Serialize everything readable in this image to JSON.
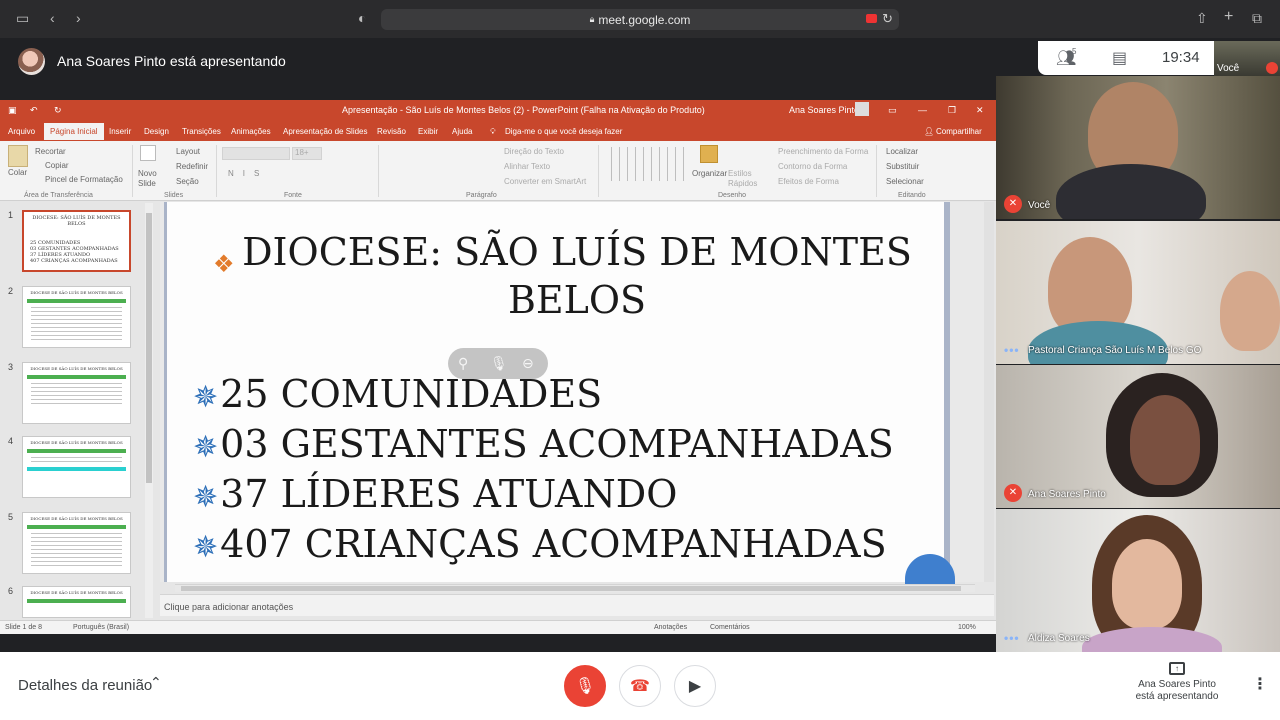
{
  "browser": {
    "url": "meet.google.com"
  },
  "meet": {
    "presenter_banner": "Ana Soares Pinto está apresentando",
    "participant_count": "5",
    "clock": "19:34",
    "self_thumb_label": "Você",
    "bottom": {
      "details_label": "Detalhes da reunião",
      "present_line1": "Ana Soares Pinto",
      "present_line2": "está apresentando"
    },
    "tiles": [
      {
        "name": "Você",
        "muted": true
      },
      {
        "name": "Pastoral Criança São Luís M Belos GO",
        "muted": false
      },
      {
        "name": "Ana Soares Pinto",
        "muted": true
      },
      {
        "name": "Aldiza Soares",
        "muted": false
      }
    ]
  },
  "ppt": {
    "title": "Apresentação - São Luís de Montes Belos (2)  -  PowerPoint (Falha na Ativação do Produto)",
    "user": "Ana Soares Pinto",
    "menu": [
      "Arquivo",
      "Página Inicial",
      "Inserir",
      "Design",
      "Transições",
      "Animações",
      "Apresentação de Slides",
      "Revisão",
      "Exibir",
      "Ajuda"
    ],
    "tell_me": "Diga-me o que você deseja fazer",
    "share": "Compartilhar",
    "ribbon": {
      "colar": "Colar",
      "recortar": "Recortar",
      "copiar": "Copiar",
      "pincel": "Pincel de Formatação",
      "area_transferencia": "Área de Transferência",
      "novo_slide": "Novo Slide",
      "layout": "Layout",
      "redefinir": "Redefinir",
      "secao": "Seção",
      "slides": "Slides",
      "fonte": "Fonte",
      "direcao_texto": "Direção do Texto",
      "alinhar_texto": "Alinhar Texto",
      "smartart": "Converter em SmartArt",
      "paragrafo": "Parágrafo",
      "organizar": "Organizar",
      "estilos_rapidos": "Estilos Rápidos",
      "preenchimento": "Preenchimento da Forma",
      "contorno": "Contorno da Forma",
      "efeitos": "Efeitos de Forma",
      "desenho": "Desenho",
      "localizar": "Localizar",
      "substituir": "Substituir",
      "selecionar": "Selecionar",
      "editando": "Editando",
      "font_size": "18+"
    },
    "thumbs": [
      {
        "num": "1",
        "title": "DIOCESE: SÃO LUÍS DE MONTES BELOS",
        "lines": [
          "25 COMUNIDADES",
          "03 GESTANTES ACOMPANHADAS",
          "37 LÍDERES ATUANDO",
          "407 CRIANÇAS ACOMPANHADAS"
        ]
      },
      {
        "num": "2",
        "title": "DIOCESE DE SÃO LUÍS DE MONTES BELOS"
      },
      {
        "num": "3",
        "title": "DIOCESE DE SÃO LUÍS DE MONTES BELOS"
      },
      {
        "num": "4",
        "title": "DIOCESE DE SÃO LUÍS DE MONTES BELOS"
      },
      {
        "num": "5",
        "title": "DIOCESE DE SÃO LUÍS DE MONTES BELOS"
      },
      {
        "num": "6",
        "title": "DIOCESE DE SÃO LUÍS DE MONTES BELOS"
      }
    ],
    "slide": {
      "title": "DIOCESE: SÃO LUÍS DE MONTES BELOS",
      "bullets": [
        "25 COMUNIDADES",
        "03 GESTANTES ACOMPANHADAS",
        "37 LÍDERES ATUANDO",
        "407 CRIANÇAS ACOMPANHADAS"
      ]
    },
    "notes_placeholder": "Clique para adicionar anotações",
    "status": {
      "slide_of": "Slide 1 de 8",
      "language": "Português (Brasil)",
      "anotacoes": "Anotações",
      "comentarios": "Comentários",
      "zoom": "100%"
    }
  },
  "colors": {
    "ppt_accent": "#c8472c",
    "meet_red": "#ea4335",
    "bullet_star": "#2d6fb8"
  }
}
